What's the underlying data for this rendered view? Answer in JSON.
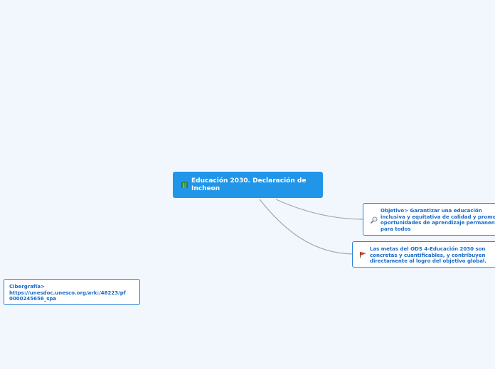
{
  "colors": {
    "background": "#f2f6fd",
    "root_fill": "#2196e8",
    "node_border": "#2b7fd8",
    "node_text": "#1769c8",
    "connector": "#9aa8b8"
  },
  "root": {
    "icon": "book-icon",
    "lines": [
      "Educación 2030. Declaración de",
      "Incheon"
    ]
  },
  "nodes": {
    "objective": {
      "icon": "magnifier-icon",
      "lines": [
        "Objetivo> Garantizar una educación",
        "inclusiva y equitativa de calidad y promover",
        "oportunidades de aprendizaje permanente",
        "para todos"
      ]
    },
    "goals": {
      "icon": "red-flag-icon",
      "lines": [
        "Las metas del ODS 4-Educación 2030 son",
        "concretas y cuantificables, y contribuyen",
        "directamente al logro del objetivo global."
      ]
    },
    "webography": {
      "lines": [
        "Cibergrafía>",
        "https://unesdoc.unesco.org/ark:/48223/pf",
        "0000245656_spa"
      ]
    }
  }
}
